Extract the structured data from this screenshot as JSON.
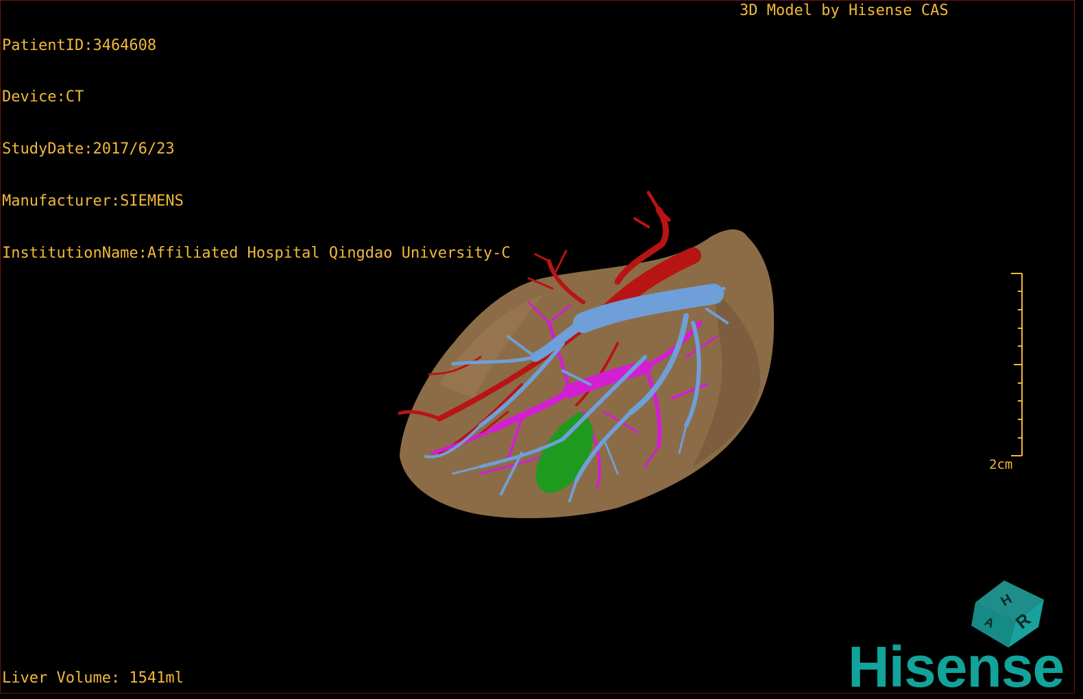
{
  "header": {
    "patient_id": "PatientID:3464608",
    "device": "Device:CT",
    "study_date": "StudyDate:2017/6/23",
    "manufacturer": "Manufacturer:SIEMENS",
    "institution": "InstitutionName:Affiliated Hospital Qingdao University-C"
  },
  "title": "3D Model by Hisense CAS",
  "footer": {
    "liver_volume": "Liver Volume: 1541ml"
  },
  "scale_bar": {
    "label": "2cm"
  },
  "orientation_cube": {
    "faces": [
      "H",
      "R",
      "A"
    ]
  },
  "brand": {
    "logo_text": "Hisense",
    "logo_color": "#12a39a"
  },
  "colors": {
    "text": "#f2b93b",
    "liver": "#8c6c47",
    "hepatic_vein": "#6f9fd8",
    "portal_vein": "#d21fd2",
    "artery": "#b81414",
    "gallbladder": "#1e9a1e",
    "frame": "#7a1010"
  }
}
